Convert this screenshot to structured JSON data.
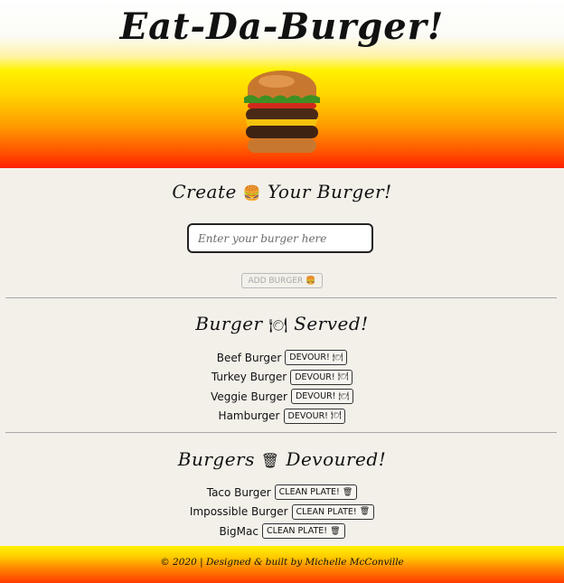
{
  "header": {
    "title": "Eat-Da-Burger!",
    "image_icon": "burger-image"
  },
  "create": {
    "title_before": "Create",
    "title_emoji": "🍔",
    "title_after": "Your Burger!",
    "input_placeholder": "Enter your burger here",
    "input_value": "",
    "add_button_label": "ADD BURGER",
    "add_button_emoji": "🍔"
  },
  "served": {
    "title_before": "Burger",
    "title_emoji": "🍽",
    "title_after": "Served!",
    "items": [
      {
        "name": "Beef Burger",
        "button_label": "DEVOUR!",
        "button_emoji": "🍽"
      },
      {
        "name": "Turkey Burger",
        "button_label": "DEVOUR!",
        "button_emoji": "🍽"
      },
      {
        "name": "Veggie Burger",
        "button_label": "DEVOUR!",
        "button_emoji": "🍽"
      },
      {
        "name": "Hamburger",
        "button_label": "DEVOUR!",
        "button_emoji": "🍽"
      }
    ]
  },
  "devoured": {
    "title_before": "Burgers",
    "title_emoji": "🗑",
    "title_after": "Devoured!",
    "items": [
      {
        "name": "Taco Burger",
        "button_label": "CLEAN PLATE!",
        "button_emoji": "🗑"
      },
      {
        "name": "Impossible Burger",
        "button_label": "CLEAN PLATE!",
        "button_emoji": "🗑"
      },
      {
        "name": "BigMac",
        "button_label": "CLEAN PLATE!",
        "button_emoji": "🗑"
      }
    ]
  },
  "footer": {
    "text": "© 2020 | Designed & built by Michelle McConville"
  }
}
